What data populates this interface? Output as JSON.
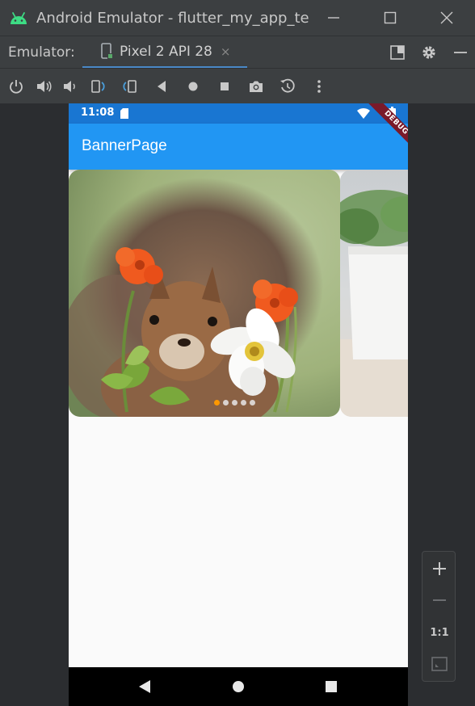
{
  "window": {
    "title": "Android Emulator - flutter_my_app_te",
    "minimize_icon": "minimize-icon",
    "maximize_icon": "maximize-icon",
    "close_icon": "close-icon"
  },
  "tabbar": {
    "emulator_label": "Emulator:",
    "tab_label": "Pixel 2 API 28",
    "tab_close": "×"
  },
  "toolbar": {
    "tools": [
      "power-icon",
      "volume-up-icon",
      "volume-down-icon",
      "rotate-left-icon",
      "rotate-right-icon",
      "back-icon",
      "home-icon",
      "overview-icon",
      "screenshot-icon",
      "snapshot-icon",
      "more-icon"
    ]
  },
  "phone": {
    "status_time": "11:08",
    "app_title": "BannerPage",
    "debug_label": "DEBUG",
    "banner_pages": 5,
    "banner_active_index": 0
  },
  "zoom": {
    "zoom_in": "+",
    "zoom_out": "−",
    "actual_size": "1:1"
  },
  "colors": {
    "accent": "#4a88c7",
    "appbar": "#2196f3",
    "statusbar": "#1976d2",
    "active_dot": "#ff9800"
  }
}
